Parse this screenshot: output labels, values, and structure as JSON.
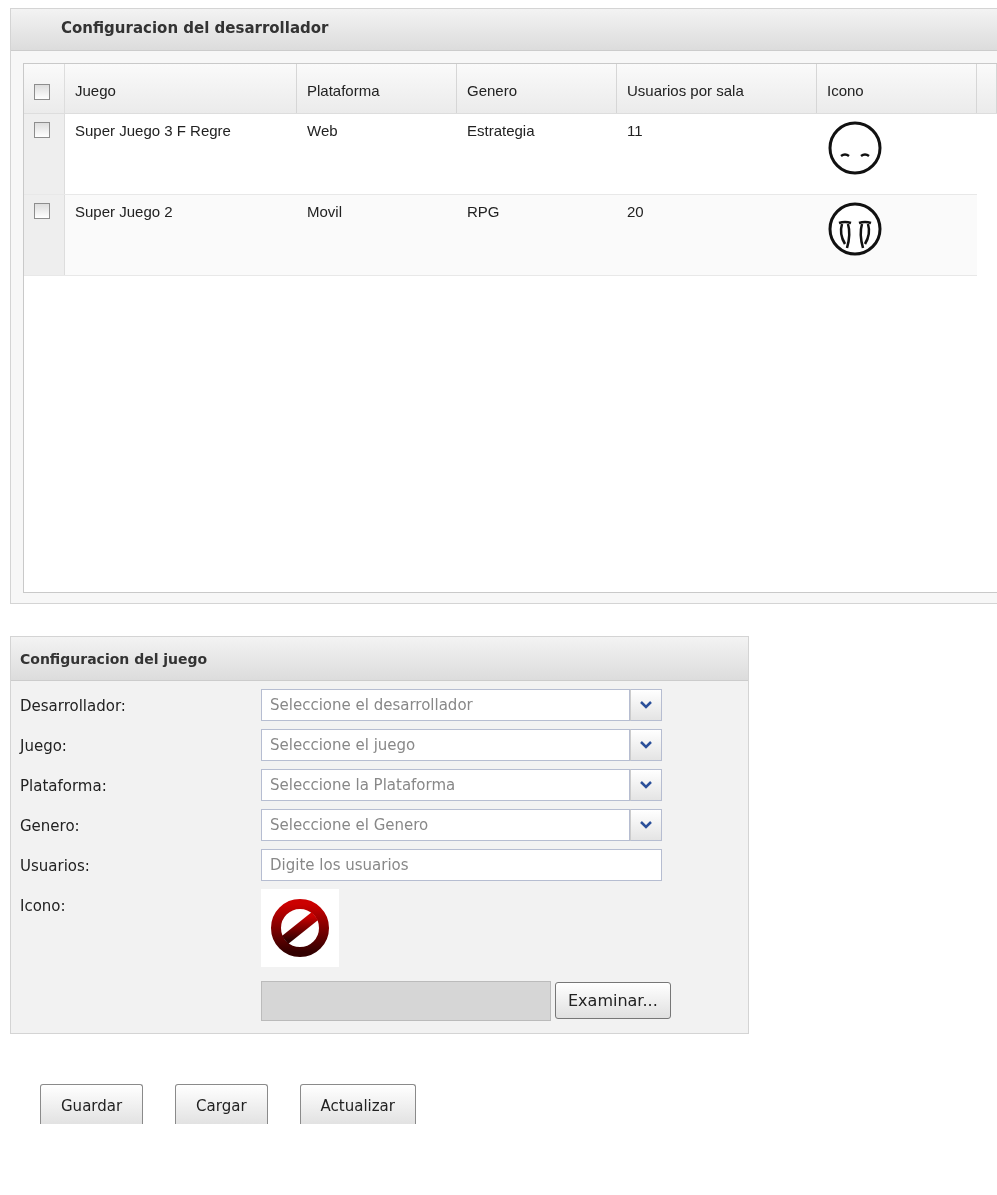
{
  "developer_panel": {
    "title": "Configuracion del desarrollador",
    "table": {
      "select_all": {
        "checked": false
      },
      "columns": [
        "Juego",
        "Plataforma",
        "Genero",
        "Usuarios por sala",
        "Icono"
      ],
      "rows": [
        {
          "checked": false,
          "kind": "sleepy",
          "cells": [
            "Super Juego 3 F Regre",
            "Web",
            "Estrategia",
            "11"
          ]
        },
        {
          "checked": false,
          "kind": "crying",
          "cells": [
            "Super Juego 2",
            "Movil",
            "RPG",
            "20"
          ]
        }
      ]
    }
  },
  "game_panel": {
    "title": "Configuracion del juego",
    "fields": [
      {
        "label": "Desarrollador:",
        "kind": "select",
        "placeholder": "Seleccione el desarrollador"
      },
      {
        "label": "Juego:",
        "kind": "select",
        "placeholder": "Seleccione el juego"
      },
      {
        "label": "Plataforma:",
        "kind": "select",
        "placeholder": "Seleccione la Plataforma"
      },
      {
        "label": "Genero:",
        "kind": "select",
        "placeholder": "Seleccione el Genero"
      },
      {
        "label": "Usuarios:",
        "kind": "text",
        "placeholder": "Digite los usuarios"
      },
      {
        "label": "Icono:",
        "kind": "image",
        "button": "Examinar..."
      }
    ]
  },
  "buttons": [
    "Guardar",
    "Cargar",
    "Actualizar"
  ]
}
